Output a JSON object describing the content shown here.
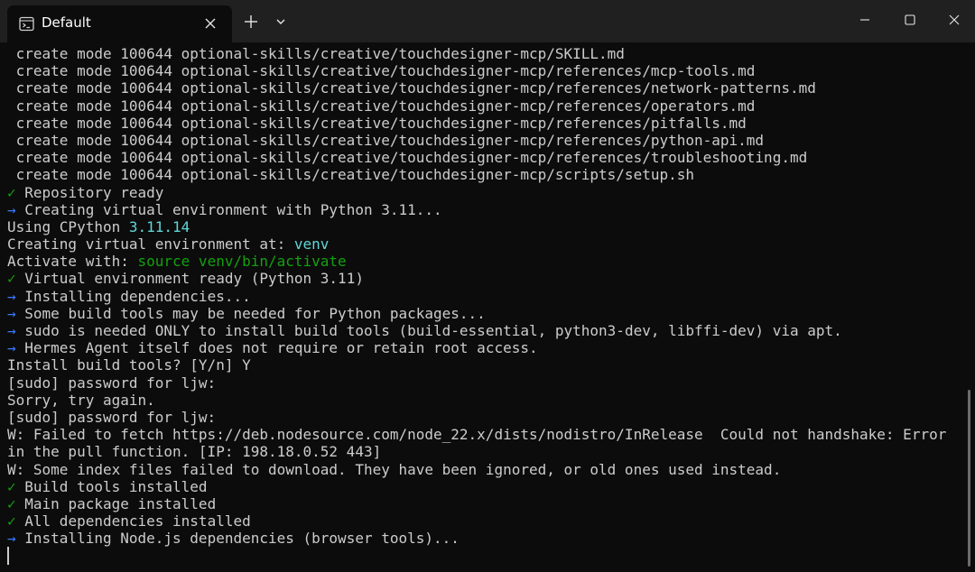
{
  "window": {
    "tab_title": "Default",
    "tab_icon": "terminal-icon",
    "controls": [
      "minimize-icon",
      "maximize-icon",
      "close-icon"
    ],
    "colors": {
      "background": "#0c0c0c",
      "titlebar": "#202020",
      "text": "#cccccc",
      "green": "#13a10e",
      "blue": "#3b78ff",
      "cyan": "#61d6d6"
    }
  },
  "terminal": {
    "lines": [
      {
        "segments": [
          {
            "text": " create mode 100644 optional-skills/creative/touchdesigner-mcp/SKILL.md"
          }
        ]
      },
      {
        "segments": [
          {
            "text": " create mode 100644 optional-skills/creative/touchdesigner-mcp/references/mcp-tools.md"
          }
        ]
      },
      {
        "segments": [
          {
            "text": " create mode 100644 optional-skills/creative/touchdesigner-mcp/references/network-patterns.md"
          }
        ]
      },
      {
        "segments": [
          {
            "text": " create mode 100644 optional-skills/creative/touchdesigner-mcp/references/operators.md"
          }
        ]
      },
      {
        "segments": [
          {
            "text": " create mode 100644 optional-skills/creative/touchdesigner-mcp/references/pitfalls.md"
          }
        ]
      },
      {
        "segments": [
          {
            "text": " create mode 100644 optional-skills/creative/touchdesigner-mcp/references/python-api.md"
          }
        ]
      },
      {
        "segments": [
          {
            "text": " create mode 100644 optional-skills/creative/touchdesigner-mcp/references/troubleshooting.md"
          }
        ]
      },
      {
        "segments": [
          {
            "text": " create mode 100644 optional-skills/creative/touchdesigner-mcp/scripts/setup.sh"
          }
        ]
      },
      {
        "segments": [
          {
            "text": "✓",
            "color": "green"
          },
          {
            "text": " Repository ready"
          }
        ]
      },
      {
        "segments": [
          {
            "text": "→",
            "color": "blue"
          },
          {
            "text": " Creating virtual environment with Python 3.11..."
          }
        ]
      },
      {
        "segments": [
          {
            "text": "Using CPython "
          },
          {
            "text": "3.11.14",
            "color": "cyan"
          }
        ]
      },
      {
        "segments": [
          {
            "text": "Creating virtual environment at: "
          },
          {
            "text": "venv",
            "color": "cyan"
          }
        ]
      },
      {
        "segments": [
          {
            "text": "Activate with: "
          },
          {
            "text": "source venv/bin/activate",
            "color": "green"
          }
        ]
      },
      {
        "segments": [
          {
            "text": "✓",
            "color": "green"
          },
          {
            "text": " Virtual environment ready (Python 3.11)"
          }
        ]
      },
      {
        "segments": [
          {
            "text": "→",
            "color": "blue"
          },
          {
            "text": " Installing dependencies..."
          }
        ]
      },
      {
        "segments": [
          {
            "text": "→",
            "color": "blue"
          },
          {
            "text": " Some build tools may be needed for Python packages..."
          }
        ]
      },
      {
        "segments": [
          {
            "text": "→",
            "color": "blue"
          },
          {
            "text": " sudo is needed ONLY to install build tools (build-essential, python3-dev, libffi-dev) via apt."
          }
        ]
      },
      {
        "segments": [
          {
            "text": "→",
            "color": "blue"
          },
          {
            "text": " Hermes Agent itself does not require or retain root access."
          }
        ]
      },
      {
        "segments": [
          {
            "text": "Install build tools? [Y/n] Y"
          }
        ]
      },
      {
        "segments": [
          {
            "text": "[sudo] password for ljw:"
          }
        ]
      },
      {
        "segments": [
          {
            "text": "Sorry, try again."
          }
        ]
      },
      {
        "segments": [
          {
            "text": "[sudo] password for ljw:"
          }
        ]
      },
      {
        "segments": [
          {
            "text": "W: Failed to fetch https://deb.nodesource.com/node_22.x/dists/nodistro/InRelease  Could not handshake: Error"
          }
        ]
      },
      {
        "segments": [
          {
            "text": "in the pull function. [IP: 198.18.0.52 443]"
          }
        ]
      },
      {
        "segments": [
          {
            "text": "W: Some index files failed to download. They have been ignored, or old ones used instead."
          }
        ]
      },
      {
        "segments": [
          {
            "text": "✓",
            "color": "green"
          },
          {
            "text": " Build tools installed"
          }
        ]
      },
      {
        "segments": [
          {
            "text": "✓",
            "color": "green"
          },
          {
            "text": " Main package installed"
          }
        ]
      },
      {
        "segments": [
          {
            "text": "✓",
            "color": "green"
          },
          {
            "text": " All dependencies installed"
          }
        ]
      },
      {
        "segments": [
          {
            "text": "→",
            "color": "blue"
          },
          {
            "text": " Installing Node.js dependencies (browser tools)..."
          }
        ]
      }
    ]
  }
}
